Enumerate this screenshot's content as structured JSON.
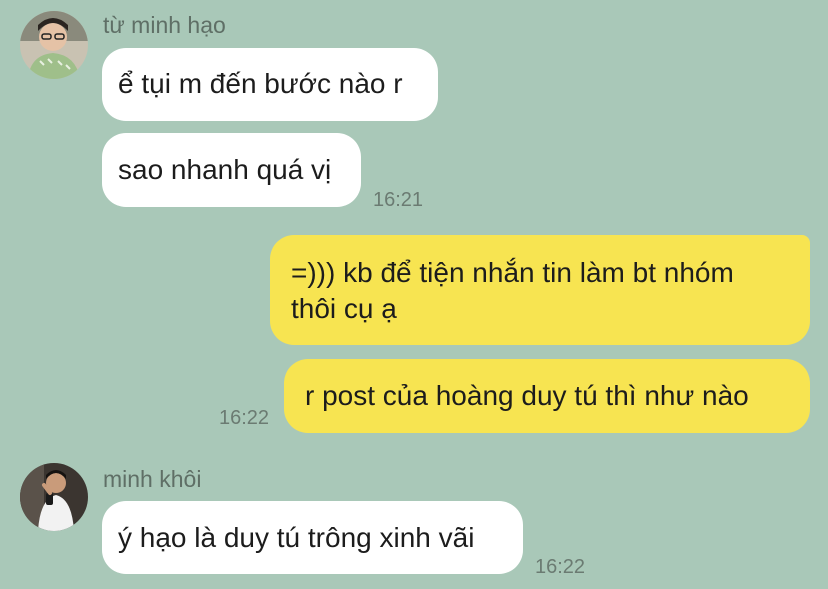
{
  "colors": {
    "background": "#a9c8b8",
    "incoming_bubble": "#ffffff",
    "outgoing_bubble": "#f7e451"
  },
  "messages": {
    "group1": {
      "sender": "từ minh hạo",
      "msg1": "ể tụi m đến bước nào r",
      "msg2": "sao nhanh quá vị",
      "time": "16:21"
    },
    "outgoing": {
      "msg1_line1": "=))) kb để tiện nhắn tin làm bt nhóm",
      "msg1_line2": "thôi cụ ạ",
      "msg2": "r post của hoàng duy tú thì như nào",
      "time": "16:22"
    },
    "group2": {
      "sender": "minh khôi",
      "msg1": "ý hạo là duy tú trông xinh vãi",
      "time": "16:22"
    }
  }
}
